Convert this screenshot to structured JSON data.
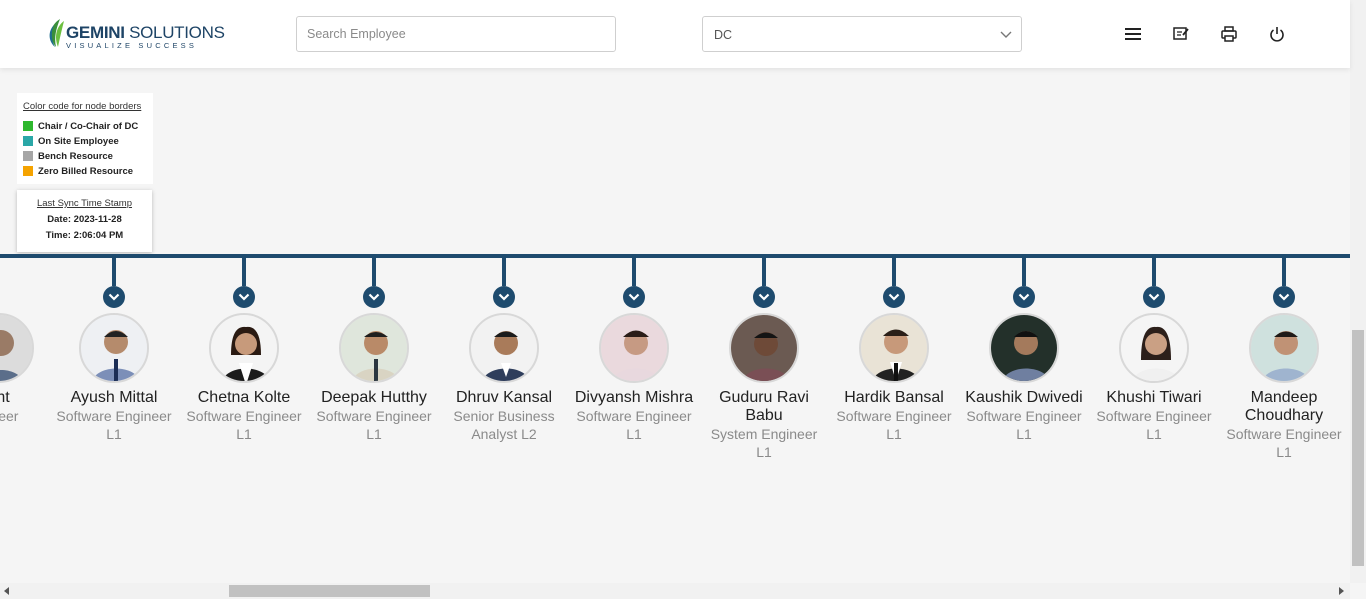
{
  "header": {
    "logo_brand": "GEMINI SOLUTIONS",
    "logo_tagline": "VISUALIZE SUCCESS",
    "search_placeholder": "Search Employee",
    "dc_select_value": "DC",
    "icons": [
      "menu-icon",
      "edit-note-icon",
      "print-icon",
      "power-icon"
    ]
  },
  "legend": {
    "title": "Color code for node borders",
    "items": [
      {
        "label": "Chair / Co-Chair of DC",
        "color": "#2eb82e"
      },
      {
        "label": "On Site Employee",
        "color": "#2aa7a7"
      },
      {
        "label": "Bench Resource",
        "color": "#a6a6a6"
      },
      {
        "label": "Zero Billed Resource",
        "color": "#f5a300"
      }
    ]
  },
  "sync": {
    "title": "Last Sync Time Stamp",
    "date_line": "Date: 2023-11-28",
    "time_line": "Time: 2:06:04 PM"
  },
  "employees": [
    {
      "name": "sht",
      "title": "gineer",
      "level": ""
    },
    {
      "name": "Ayush Mittal",
      "title": "Software Engineer",
      "level": "L1"
    },
    {
      "name": "Chetna Kolte",
      "title": "Software Engineer",
      "level": "L1"
    },
    {
      "name": "Deepak Hutthy",
      "title": "Software Engineer",
      "level": "L1"
    },
    {
      "name": "Dhruv Kansal",
      "title": "Senior Business",
      "level": "Analyst L2"
    },
    {
      "name": "Divyansh Mishra",
      "title": "Software Engineer",
      "level": "L1"
    },
    {
      "name": "Guduru Ravi Babu",
      "title": "System Engineer",
      "level": "L1"
    },
    {
      "name": "Hardik Bansal",
      "title": "Software Engineer",
      "level": "L1"
    },
    {
      "name": "Kaushik Dwivedi",
      "title": "Software Engineer",
      "level": "L1"
    },
    {
      "name": "Khushi Tiwari",
      "title": "Software Engineer",
      "level": "L1"
    },
    {
      "name": "Mandeep Choudhary",
      "title": "Software Engineer",
      "level": "L1"
    }
  ],
  "colors": {
    "accent": "#1e4b6e",
    "header_bg": "#ffffff",
    "page_bg": "#f5f5f5"
  }
}
